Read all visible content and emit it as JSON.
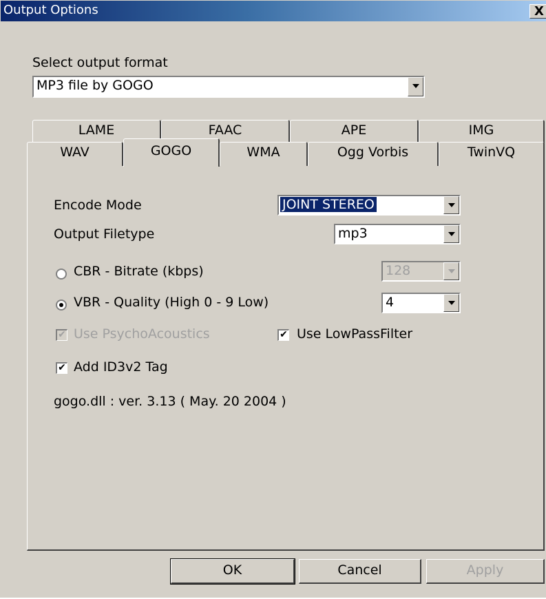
{
  "window": {
    "title": "Output Options",
    "close_glyph": "X"
  },
  "format": {
    "label": "Select output format",
    "selected": "MP3 file by GOGO"
  },
  "tabs_back": [
    "LAME",
    "FAAC",
    "APE",
    "IMG"
  ],
  "tabs_front": [
    "WAV",
    "GOGO",
    "WMA",
    "Ogg Vorbis",
    "TwinVQ"
  ],
  "active_tab": "GOGO",
  "settings": {
    "encode_mode": {
      "label": "Encode Mode",
      "value": "JOINT STEREO"
    },
    "output_filetype": {
      "label": "Output Filetype",
      "value": "mp3"
    },
    "cbr": {
      "label": "CBR - Bitrate (kbps)",
      "value": "128",
      "checked": false
    },
    "vbr": {
      "label": "VBR - Quality (High 0 - 9 Low)",
      "value": "4",
      "checked": true
    },
    "psycho": {
      "label": "Use PsychoAcoustics",
      "checked": true,
      "enabled": false
    },
    "lowpass": {
      "label": "Use LowPassFilter",
      "checked": true
    },
    "id3": {
      "label": "Add ID3v2 Tag",
      "checked": true
    },
    "version": "gogo.dll : ver. 3.13 ( May. 20 2004 )"
  },
  "buttons": {
    "ok": "OK",
    "cancel": "Cancel",
    "apply": "Apply"
  },
  "colors": {
    "face": "#d4d0c8",
    "title_start": "#0a246a",
    "title_end": "#a6caf0",
    "selection": "#0a246a"
  }
}
